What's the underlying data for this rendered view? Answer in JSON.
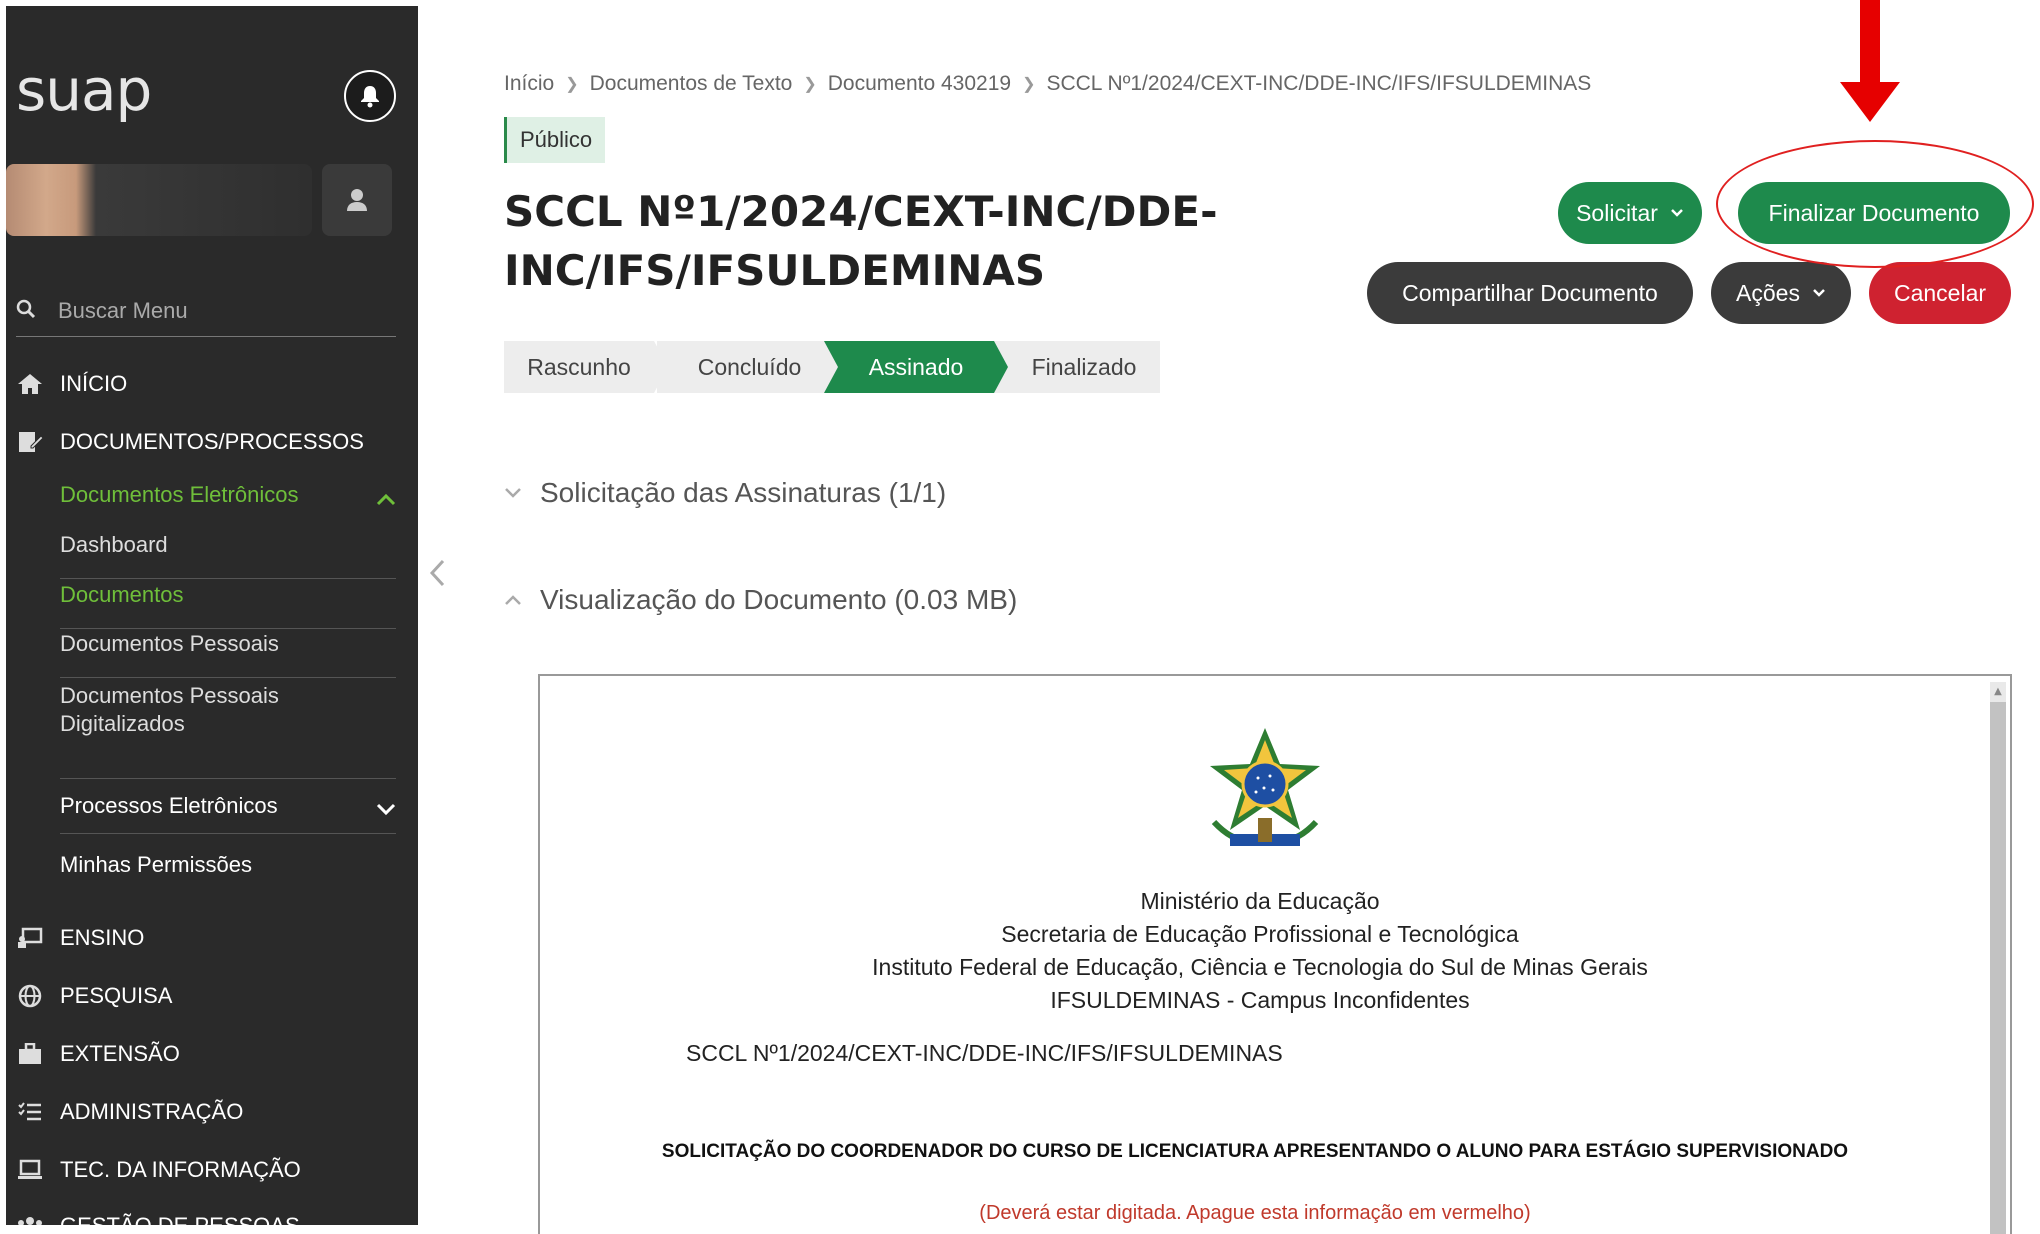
{
  "sidebar": {
    "logo": "suap",
    "search_placeholder": "Buscar Menu",
    "menu": {
      "inicio": "INÍCIO",
      "documentos_processos": "DOCUMENTOS/PROCESSOS",
      "documentos_eletronicos": "Documentos Eletrônicos",
      "dashboard": "Dashboard",
      "documentos": "Documentos",
      "documentos_pessoais": "Documentos Pessoais",
      "documentos_pessoais_digitalizados": "Documentos Pessoais Digitalizados",
      "processos_eletronicos": "Processos Eletrônicos",
      "minhas_permissoes": "Minhas Permissões",
      "ensino": "ENSINO",
      "pesquisa": "PESQUISA",
      "extensao": "EXTENSÃO",
      "administracao": "ADMINISTRAÇÃO",
      "tec_informacao": "TEC. DA INFORMAÇÃO",
      "gestao_pessoas": "GESTÃO DE PESSOAS"
    }
  },
  "breadcrumb": [
    "Início",
    "Documentos de Texto",
    "Documento 430219",
    "SCCL Nº1/2024/CEXT-INC/DDE-INC/IFS/IFSULDEMINAS"
  ],
  "badge": "Público",
  "title": "SCCL Nº1/2024/CEXT-INC/DDE-INC/IFS/IFSULDEMINAS",
  "actions": {
    "solicitar": "Solicitar",
    "finalizar": "Finalizar Documento",
    "compartilhar": "Compartilhar Documento",
    "acoes": "Ações",
    "cancelar": "Cancelar"
  },
  "steps": [
    "Rascunho",
    "Concluído",
    "Assinado",
    "Finalizado"
  ],
  "active_step": "Assinado",
  "sections": {
    "assinaturas": "Solicitação das Assinaturas (1/1)",
    "visualizacao": "Visualização do Documento (0.03 MB)"
  },
  "document": {
    "header_lines": [
      "Ministério da Educação",
      "Secretaria de Educação Profissional e Tecnológica",
      "Instituto Federal de Educação, Ciência e Tecnologia do Sul de Minas Gerais",
      "IFSULDEMINAS - Campus Inconfidentes"
    ],
    "reference": "SCCL Nº1/2024/CEXT-INC/DDE-INC/IFS/IFSULDEMINAS",
    "heading": "SOLICITAÇÃO DO COORDENADOR DO CURSO DE LICENCIATURA APRESENTANDO O ALUNO PARA ESTÁGIO SUPERVISIONADO",
    "note": "(Deverá estar digitada. Apague esta informação em vermelho)"
  },
  "colors": {
    "sidebar_bg": "#2a2a2a",
    "accent_green": "#1e8a4c",
    "menu_active_green": "#6fbf3a",
    "danger_red": "#cf2230",
    "annotation_red": "#e02020"
  }
}
